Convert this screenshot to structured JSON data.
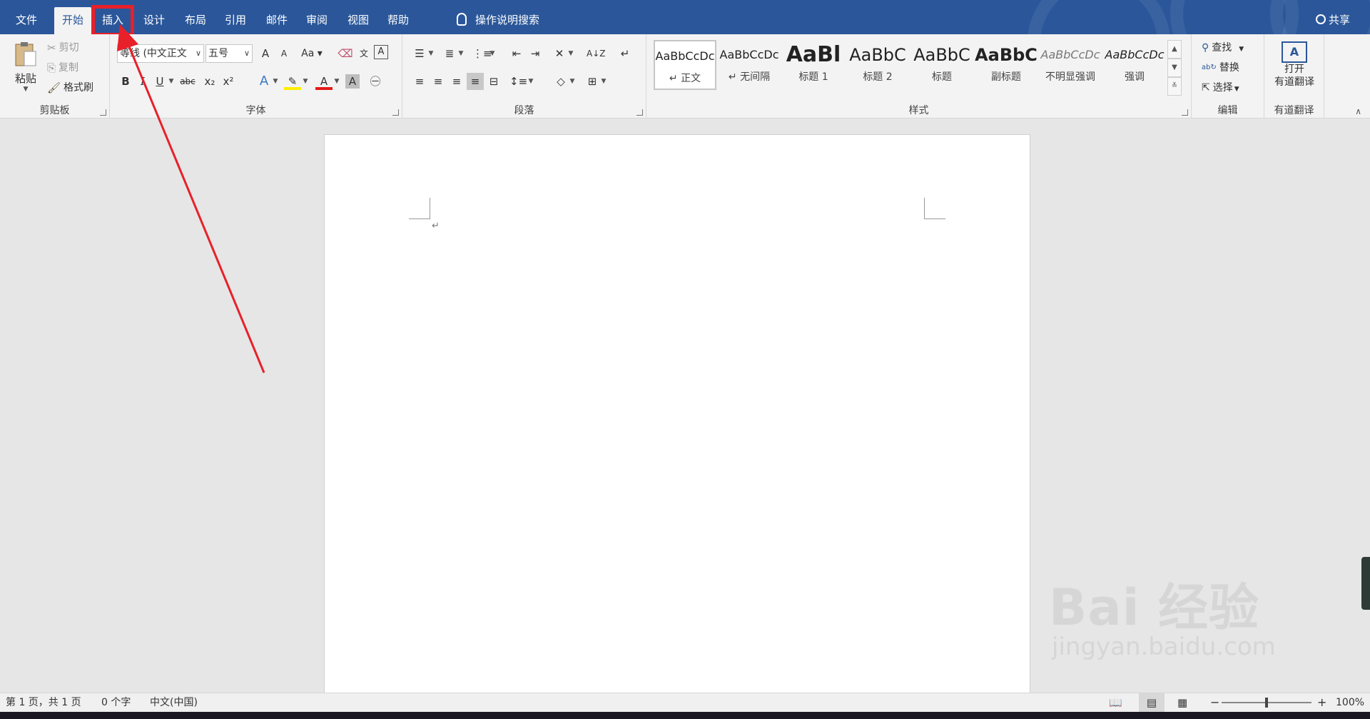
{
  "tabs": [
    {
      "label": "文件"
    },
    {
      "label": "开始"
    },
    {
      "label": "插入"
    },
    {
      "label": "设计"
    },
    {
      "label": "布局"
    },
    {
      "label": "引用"
    },
    {
      "label": "邮件"
    },
    {
      "label": "审阅"
    },
    {
      "label": "视图"
    },
    {
      "label": "帮助"
    }
  ],
  "active_tab": "开始",
  "highlighted_tab": "插入",
  "tell_me": "操作说明搜索",
  "share": "共享",
  "clipboard": {
    "paste": "粘贴",
    "cut": "剪切",
    "copy": "复制",
    "format_painter": "格式刷",
    "label": "剪贴板"
  },
  "font": {
    "name": "等线 (中文正文",
    "size": "五号",
    "label": "字体",
    "grow": "A",
    "shrink": "A",
    "case": "Aa",
    "bold": "B",
    "italic": "I",
    "underline": "U",
    "strike": "abc",
    "sub": "x₂",
    "sup": "x²"
  },
  "paragraph": {
    "label": "段落"
  },
  "styles": {
    "label": "样式",
    "items": [
      {
        "preview": "AaBbCcDc",
        "name": "↵ 正文"
      },
      {
        "preview": "AaBbCcDc",
        "name": "↵ 无间隔"
      },
      {
        "preview": "AaBl",
        "name": "标题 1"
      },
      {
        "preview": "AaBbC",
        "name": "标题 2"
      },
      {
        "preview": "AaBbC",
        "name": "标题"
      },
      {
        "preview": "AaBbC",
        "name": "副标题"
      },
      {
        "preview": "AaBbCcDc",
        "name": "不明显强调"
      },
      {
        "preview": "AaBbCcDc",
        "name": "强调"
      }
    ]
  },
  "editing": {
    "find": "查找",
    "replace": "替换",
    "select": "选择",
    "label": "编辑"
  },
  "youdao": {
    "open": "打开",
    "translate": "有道翻译",
    "label": "有道翻译"
  },
  "status": {
    "page": "第 1 页，共 1 页",
    "words": "0 个字",
    "language": "中文(中国)",
    "zoom": "100%",
    "zoom_minus": "−",
    "zoom_plus": "+"
  },
  "watermark": {
    "brand": "Bai 经验",
    "url": "jingyan.baidu.com"
  },
  "colors": {
    "title_bar": "#2b579a",
    "annotation": "#e8202a"
  }
}
